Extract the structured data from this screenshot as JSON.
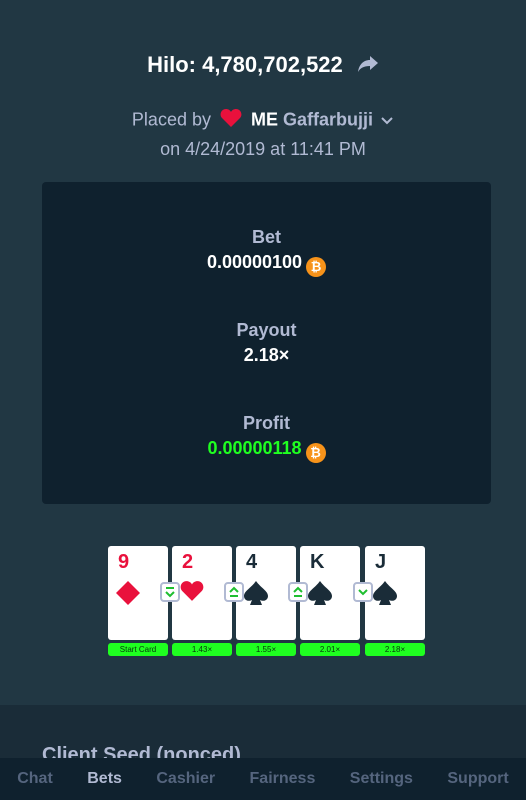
{
  "bet": {
    "title": "Hilo: 4,780,702,522",
    "placed_by_prefix": "Placed by",
    "placed_by_tag": "ME",
    "placed_by_user": "Gaffarbujji",
    "date": "on 4/24/2019 at 11:41 PM"
  },
  "stats": {
    "bet_label": "Bet",
    "bet_value": "0.00000100",
    "payout_label": "Payout",
    "payout_value": "2.18×",
    "profit_label": "Profit",
    "profit_value": "0.00000118"
  },
  "currency_icon": "bitcoin-icon",
  "colors": {
    "profit": "#1fff20",
    "bitcoin": "#f7931a",
    "red_suit": "#e9113c"
  },
  "cards": [
    {
      "rank": "9",
      "suit": "diamonds",
      "multiplier": "Start Card"
    },
    {
      "rank": "2",
      "suit": "hearts",
      "multiplier": "1.43×"
    },
    {
      "rank": "4",
      "suit": "spades",
      "multiplier": "1.55×"
    },
    {
      "rank": "K",
      "suit": "spades",
      "multiplier": "2.01×"
    },
    {
      "rank": "J",
      "suit": "spades",
      "multiplier": "2.18×"
    }
  ],
  "guesses": [
    "lower-or-same",
    "higher-or-same",
    "higher-or-same",
    "lower-or-same"
  ],
  "seed_section": {
    "label": "Client Seed (nonced)"
  },
  "nav": {
    "chat": "Chat",
    "bets": "Bets",
    "cashier": "Cashier",
    "fairness": "Fairness",
    "settings": "Settings",
    "support": "Support"
  }
}
